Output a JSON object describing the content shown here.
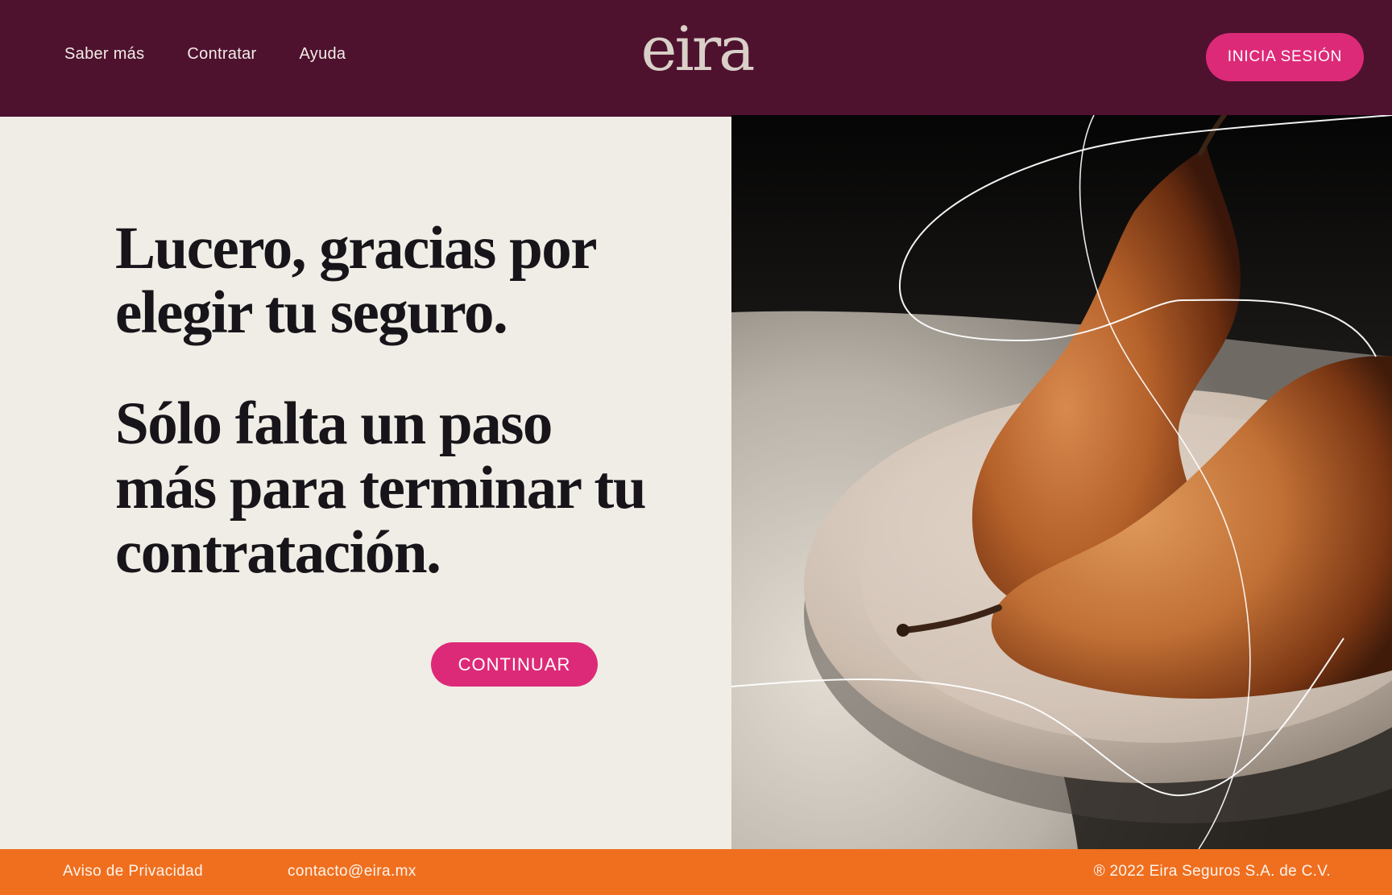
{
  "header": {
    "nav": [
      {
        "label": "Saber más"
      },
      {
        "label": "Contratar"
      },
      {
        "label": "Ayuda"
      }
    ],
    "logo_text": "eira",
    "login_label": "INICIA SESIÓN"
  },
  "main": {
    "headline_1": "Lucero, gracias por elegir tu seguro.",
    "headline_2": "Sólo falta un paso más para terminar tu contratación.",
    "continue_label": "CONTINUAR"
  },
  "footer": {
    "privacy_label": "Aviso de Privacidad",
    "email": "contacto@eira.mx",
    "copyright": "® 2022 Eira Seguros S.A. de C.V."
  },
  "colors": {
    "header_bg": "#4e122f",
    "accent": "#dd2a78",
    "panel_bg": "#f0ede6",
    "footer_bg": "#ef6f1f"
  }
}
